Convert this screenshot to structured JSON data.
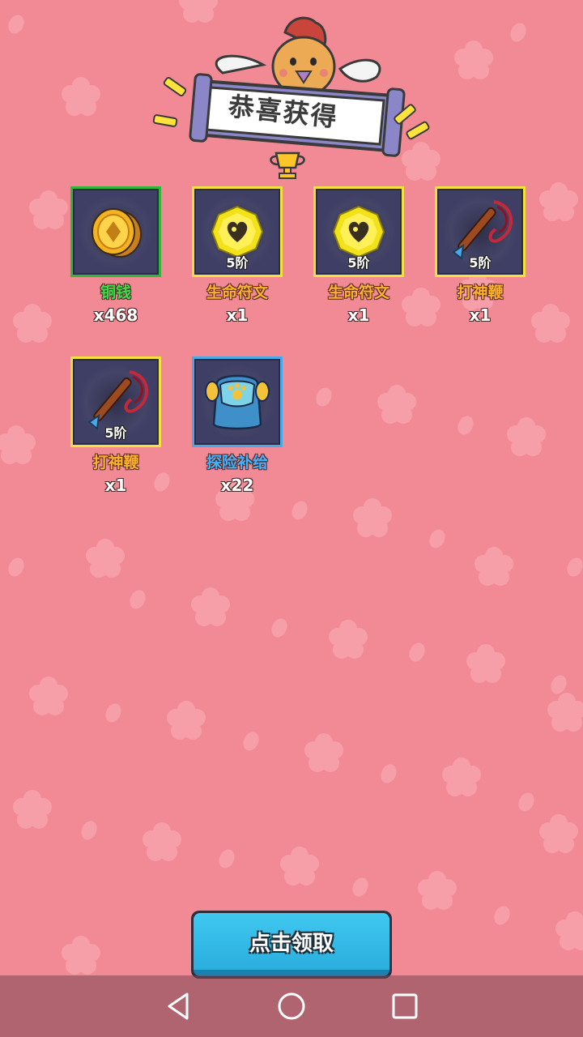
{
  "banner": {
    "title": "恭喜获得"
  },
  "rewards": [
    {
      "name": "铜钱",
      "qty": "x468",
      "tier": "",
      "icon": "copper-coin-icon",
      "frame": "green",
      "name_color": "#37e04a"
    },
    {
      "name": "生命符文",
      "qty": "x1",
      "tier": "5阶",
      "icon": "life-rune-icon",
      "frame": "yellow",
      "name_color": "#ffb22a"
    },
    {
      "name": "生命符文",
      "qty": "x1",
      "tier": "5阶",
      "icon": "life-rune-icon",
      "frame": "yellow",
      "name_color": "#ffb22a"
    },
    {
      "name": "打神鞭",
      "qty": "x1",
      "tier": "5阶",
      "icon": "whip-icon",
      "frame": "yellow",
      "name_color": "#ffb22a"
    },
    {
      "name": "打神鞭",
      "qty": "x1",
      "tier": "5阶",
      "icon": "whip-icon",
      "frame": "yellow",
      "name_color": "#ffb22a"
    },
    {
      "name": "探险补给",
      "qty": "x22",
      "tier": "",
      "icon": "supply-backpack-icon",
      "frame": "blue",
      "name_color": "#3fb4ff"
    }
  ],
  "claim_button": {
    "label": "点击领取"
  },
  "nav": {
    "back": "back-icon",
    "home": "home-icon",
    "recents": "recents-icon"
  }
}
